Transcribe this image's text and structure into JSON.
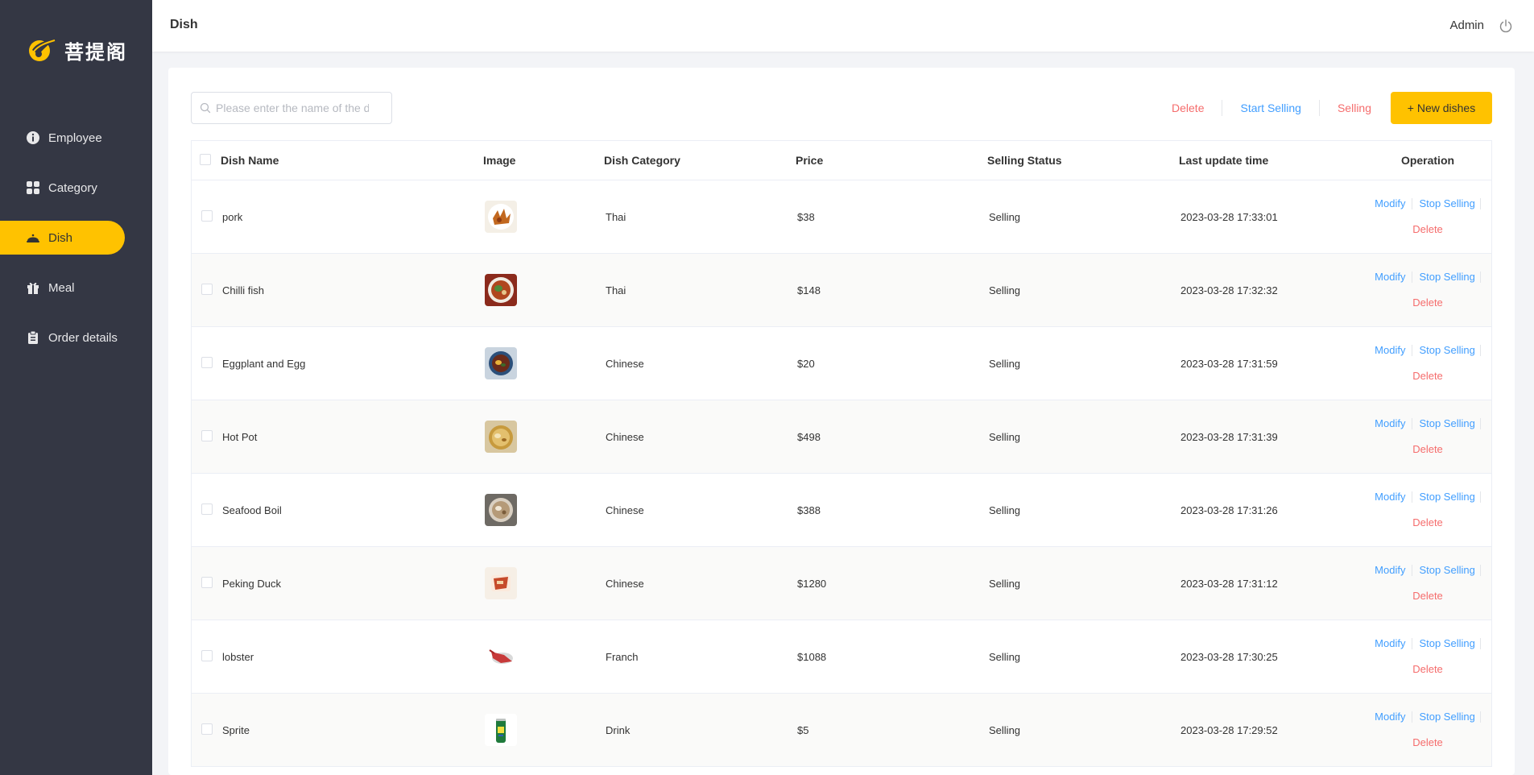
{
  "brand": {
    "name": "菩提阁"
  },
  "sidebar": {
    "items": [
      {
        "label": "Employee",
        "icon": "info-icon",
        "active": false
      },
      {
        "label": "Category",
        "icon": "grid-icon",
        "active": false
      },
      {
        "label": "Dish",
        "icon": "dish-cover-icon",
        "active": true
      },
      {
        "label": "Meal",
        "icon": "gift-icon",
        "active": false
      },
      {
        "label": "Order details",
        "icon": "clipboard-icon",
        "active": false
      }
    ]
  },
  "header": {
    "title": "Dish",
    "user": "Admin",
    "logout_icon": "power-icon"
  },
  "search": {
    "placeholder": "Please enter the name of the dish",
    "value": ""
  },
  "toolbar": {
    "delete_label": "Delete",
    "start_selling_label": "Start Selling",
    "selling_label": "Selling",
    "new_label": "+ New dishes"
  },
  "table": {
    "columns": [
      "Dish Name",
      "Image",
      "Dish Category",
      "Price",
      "Selling Status",
      "Last update time",
      "Operation"
    ],
    "actions": {
      "modify": "Modify",
      "stop": "Stop Selling",
      "delete": "Delete"
    },
    "rows": [
      {
        "name": "pork",
        "image": "fried-pork-photo",
        "category": "Thai",
        "price": "$38",
        "status": "Selling",
        "updated": "2023-03-28 17:33:01"
      },
      {
        "name": "Chilli fish",
        "image": "chilli-fish-photo",
        "category": "Thai",
        "price": "$148",
        "status": "Selling",
        "updated": "2023-03-28 17:32:32"
      },
      {
        "name": "Eggplant and Egg",
        "image": "eggplant-egg-photo",
        "category": "Chinese",
        "price": "$20",
        "status": "Selling",
        "updated": "2023-03-28 17:31:59"
      },
      {
        "name": "Hot Pot",
        "image": "hot-pot-photo",
        "category": "Chinese",
        "price": "$498",
        "status": "Selling",
        "updated": "2023-03-28 17:31:39"
      },
      {
        "name": "Seafood Boil",
        "image": "seafood-boil-photo",
        "category": "Chinese",
        "price": "$388",
        "status": "Selling",
        "updated": "2023-03-28 17:31:26"
      },
      {
        "name": "Peking Duck",
        "image": "peking-duck-photo",
        "category": "Chinese",
        "price": "$1280",
        "status": "Selling",
        "updated": "2023-03-28 17:31:12"
      },
      {
        "name": "lobster",
        "image": "lobster-photo",
        "category": "Franch",
        "price": "$1088",
        "status": "Selling",
        "updated": "2023-03-28 17:30:25"
      },
      {
        "name": "Sprite",
        "image": "sprite-can-photo",
        "category": "Drink",
        "price": "$5",
        "status": "Selling",
        "updated": "2023-03-28 17:29:52"
      }
    ]
  },
  "colors": {
    "sidebar_bg": "#343744",
    "accent": "#ffc200",
    "link_blue": "#419eff",
    "danger_red": "#f56c6c"
  }
}
